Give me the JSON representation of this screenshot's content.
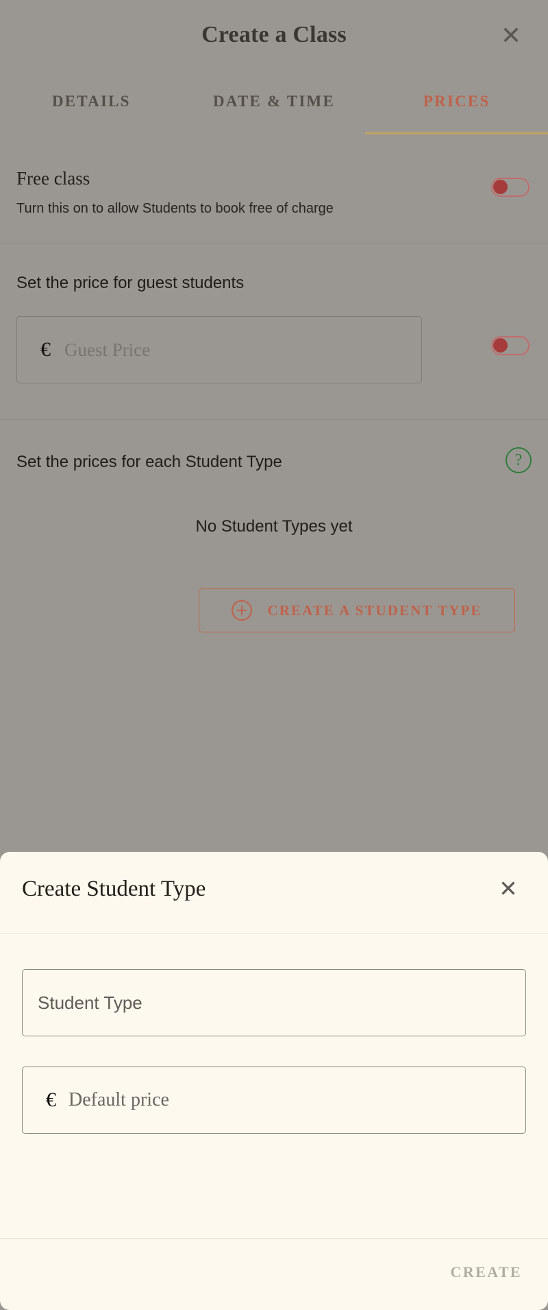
{
  "class_modal": {
    "title": "Create a Class",
    "close_icon": "close-icon",
    "tabs": [
      {
        "label": "DETAILS",
        "active": false
      },
      {
        "label": "DATE & TIME",
        "active": false
      },
      {
        "label": "PRICES",
        "active": true
      }
    ],
    "free_class": {
      "title": "Free class",
      "description": "Turn this on to allow Students to book free of charge",
      "toggle_state": "off"
    },
    "guest_price": {
      "label": "Set the price for guest students",
      "currency_symbol": "€",
      "input_placeholder": "Guest Price",
      "input_value": "",
      "toggle_state": "off"
    },
    "student_types": {
      "label": "Set the prices for each Student Type",
      "help_icon": "question-mark-icon",
      "empty_message": "No Student Types yet",
      "create_button_label": "CREATE A STUDENT TYPE",
      "create_button_icon": "plus-circle-icon"
    }
  },
  "sheet": {
    "title": "Create Student Type",
    "close_icon": "close-icon",
    "name_field": {
      "placeholder": "Student Type",
      "value": ""
    },
    "price_field": {
      "currency_symbol": "€",
      "placeholder": "Default price",
      "value": ""
    },
    "create_label": "CREATE"
  },
  "colors": {
    "backdrop": "#9a9792",
    "accent_red": "#c0614a",
    "tab_underline": "#c2a464",
    "toggle_border": "#c06c6c",
    "toggle_knob": "#a53b3b",
    "help_green": "#2f7d3b",
    "sheet_background": "#fdf9ee",
    "create_disabled": "#b0aca2"
  }
}
